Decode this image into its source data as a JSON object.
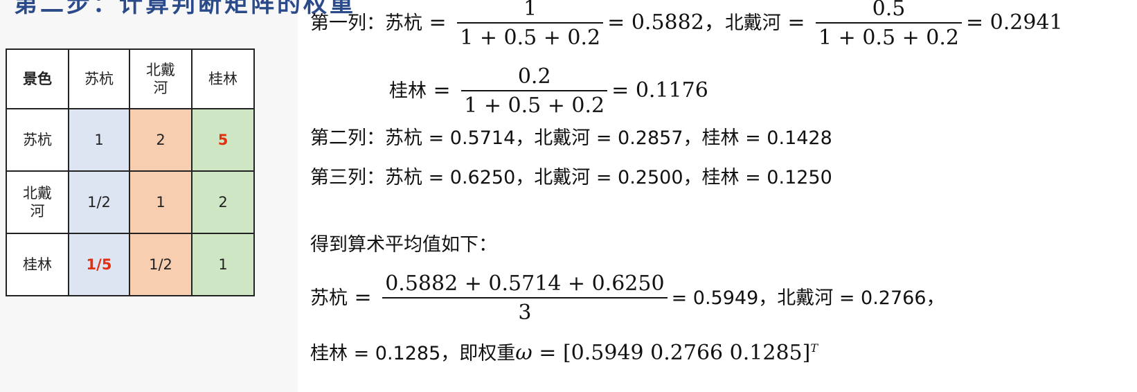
{
  "title_partial": "第二步：计算判断矩阵的权重",
  "table": {
    "headers": [
      "景色",
      "苏杭",
      "北戴\n河",
      "桂林"
    ],
    "rows": [
      {
        "label": "苏杭",
        "cells": [
          "1",
          "2",
          "5"
        ]
      },
      {
        "label": "北戴\n河",
        "cells": [
          "1/2",
          "1",
          "2"
        ]
      },
      {
        "label": "桂林",
        "cells": [
          "1/5",
          "1/2",
          "1"
        ]
      }
    ]
  },
  "colors": {
    "col_suhang": "#dde4f2",
    "col_beidaihe": "#f7ceb0",
    "col_guilin": "#cfe6c4",
    "highlight": "#e03010",
    "header_text": "#2a4a8a"
  },
  "col1": {
    "prefix": "第一列：",
    "a_name": "苏杭",
    "a_num": "1",
    "a_den": "1 + 0.5 + 0.2",
    "a_val": "= 0.5882，",
    "b_name": "北戴河",
    "b_num": "0.5",
    "b_den": "1 + 0.5 + 0.2",
    "b_val": "= 0.2941",
    "c_name": "桂林",
    "c_num": "0.2",
    "c_den": "1 + 0.5 + 0.2",
    "c_val": "= 0.1176"
  },
  "col2": "第二列：苏杭 = 0.5714，北戴河 = 0.2857，桂林 = 0.1428",
  "col3": "第三列：苏杭 = 0.6250，北戴河 = 0.2500，桂林 = 0.1250",
  "avg_intro": "得到算术平均值如下：",
  "avg": {
    "a_name": "苏杭",
    "num": "0.5882 + 0.5714 + 0.6250",
    "den": "3",
    "rest": "= 0.5949，北戴河 = 0.2766，"
  },
  "final": {
    "text": "桂林 = 0.1285，即权重",
    "omega": "ω",
    "vector": "= [0.5949  0.2766  0.1285]",
    "sup": "T"
  }
}
